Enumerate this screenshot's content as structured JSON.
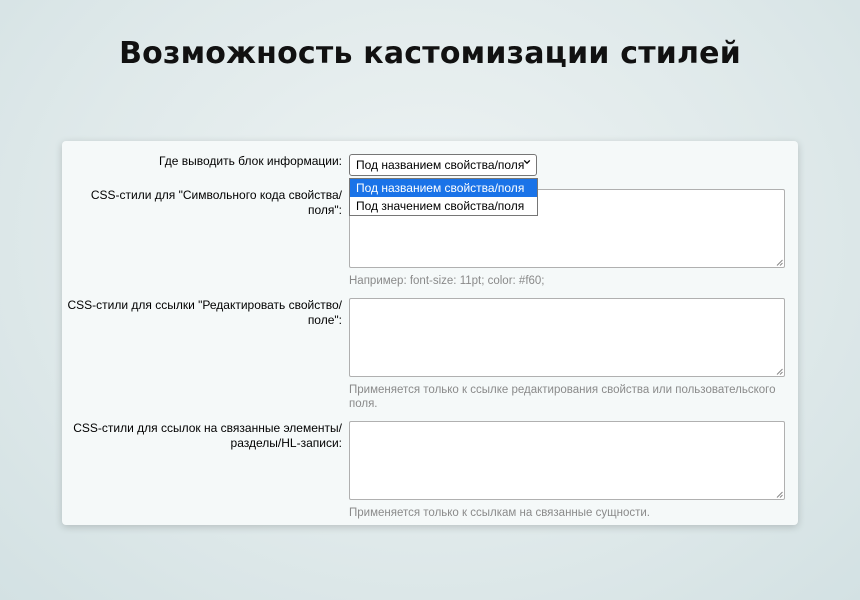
{
  "headline": "Возможность кастомизации стилей",
  "form": {
    "display_location": {
      "label": "Где выводить блок информации:",
      "selected": "Под названием свойства/поля",
      "options": [
        "Под названием свойства/поля",
        "Под значением свойства/поля"
      ]
    },
    "code_css": {
      "label_line1": "CSS-стили для \"Символьного кода свойства/",
      "label_line2": "поля\":",
      "value": "",
      "hint": "Например: font-size: 11pt; color: #f60;"
    },
    "edit_link_css": {
      "label_line1": "CSS-стили для ссылки \"Редактировать свойство/",
      "label_line2": "поле\":",
      "value": "",
      "hint_line1": "Применяется только к ссылке редактирования свойства или пользовательского",
      "hint_line2": "поля."
    },
    "related_css": {
      "label_line1": "CSS-стили для ссылок на связанные элементы/",
      "label_line2": "разделы/HL-записи:",
      "value": "",
      "hint": "Применяется только к ссылкам на связанные сущности."
    }
  },
  "colors": {
    "selected_option": "#1a73e8",
    "hint_text": "#8a8a8a"
  },
  "icons": [
    "chevron-down-icon",
    "resize-grip-icon"
  ]
}
